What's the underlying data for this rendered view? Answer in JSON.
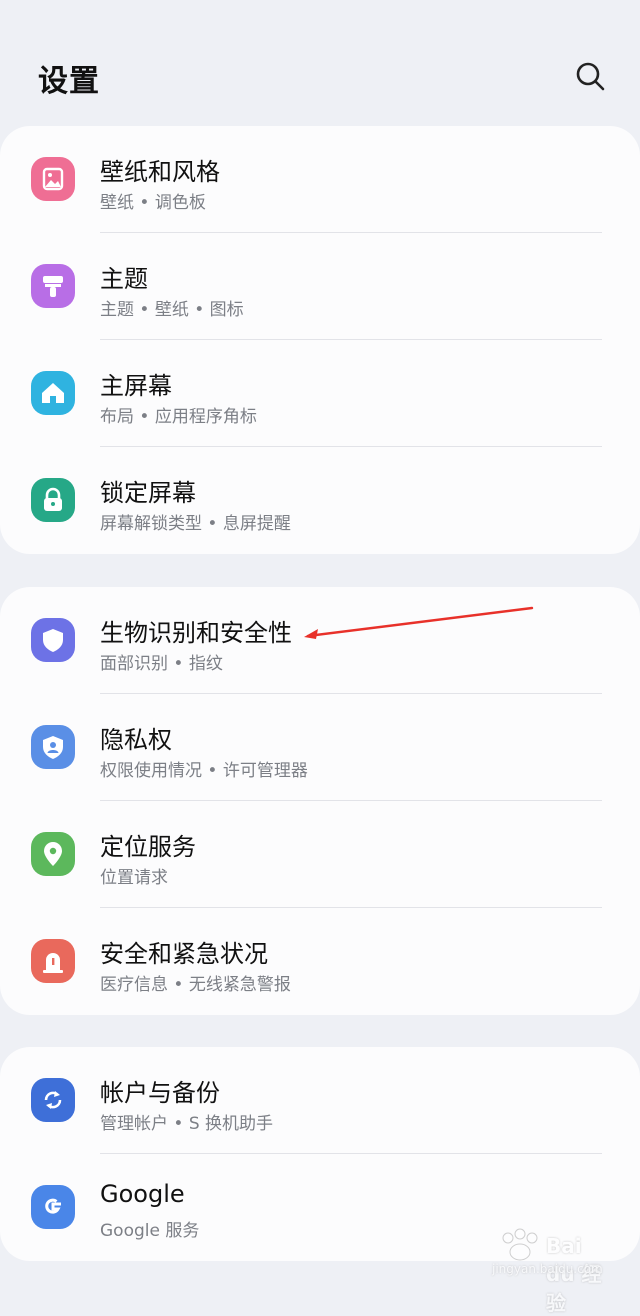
{
  "header": {
    "title": "设置"
  },
  "groups": [
    {
      "items": [
        {
          "title": "壁纸和风格",
          "subtitle": "壁纸 • 调色板",
          "icon": "wallpaper-icon",
          "color": "#ef6e94"
        },
        {
          "title": "主题",
          "subtitle": "主题 • 壁纸 • 图标",
          "icon": "theme-brush-icon",
          "color": "#b86ee6"
        },
        {
          "title": "主屏幕",
          "subtitle": "布局 • 应用程序角标",
          "icon": "home-icon",
          "color": "#2fb3e0"
        },
        {
          "title": "锁定屏幕",
          "subtitle": "屏幕解锁类型 • 息屏提醒",
          "icon": "lock-icon",
          "color": "#26a887"
        }
      ]
    },
    {
      "items": [
        {
          "title": "生物识别和安全性",
          "subtitle": "面部识别 • 指纹",
          "icon": "shield-icon",
          "color": "#6d72e6"
        },
        {
          "title": "隐私权",
          "subtitle": "权限使用情况 • 许可管理器",
          "icon": "privacy-shield-icon",
          "color": "#5a8fe6"
        },
        {
          "title": "定位服务",
          "subtitle": "位置请求",
          "icon": "location-pin-icon",
          "color": "#5cb85c"
        },
        {
          "title": "安全和紧急状况",
          "subtitle": "医疗信息 • 无线紧急警报",
          "icon": "emergency-icon",
          "color": "#e9695c"
        }
      ]
    },
    {
      "items": [
        {
          "title": "帐户与备份",
          "subtitle": "管理帐户 • S 换机助手",
          "icon": "sync-icon",
          "color": "#3e6fd8"
        },
        {
          "title": "Google",
          "subtitle": "Google 服务",
          "icon": "google-icon",
          "color": "#4a86e8"
        }
      ]
    }
  ],
  "annotation": {
    "color": "#e8312a"
  },
  "watermark": {
    "brand": "Bai du 经验",
    "url": "jingyan.baidu.com"
  }
}
